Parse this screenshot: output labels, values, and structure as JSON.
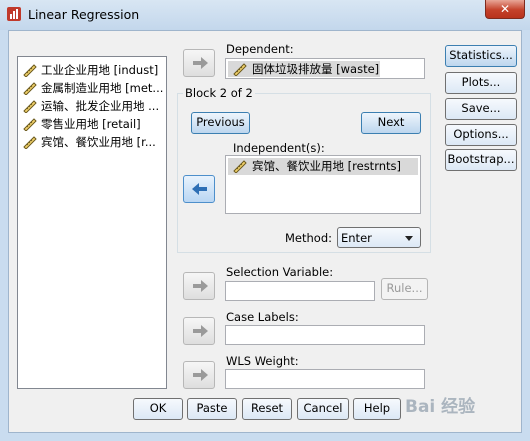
{
  "window": {
    "title": "Linear Regression",
    "close_label": "✕"
  },
  "variable_list": [
    "工业企业用地 [indust]",
    "金属制造业用地 [met...",
    "运输、批发企业用地 ...",
    "零售业用地 [retail]",
    "宾馆、餐饮业用地 [r..."
  ],
  "dependent": {
    "label": "Dependent:",
    "value": "固体垃圾排放量 [waste]"
  },
  "block": {
    "title": "Block 2 of 2",
    "previous_label": "Previous",
    "next_label": "Next",
    "independent_label": "Independent(s):",
    "independent_items": [
      "宾馆、餐饮业用地 [restrnts]"
    ]
  },
  "method": {
    "label": "Method:",
    "value": "Enter"
  },
  "selection_variable": {
    "label": "Selection Variable:",
    "value": "",
    "rule_label": "Rule..."
  },
  "case_labels": {
    "label": "Case Labels:",
    "value": ""
  },
  "wls_weight": {
    "label": "WLS Weight:",
    "value": ""
  },
  "side_buttons": [
    "Statistics...",
    "Plots...",
    "Save...",
    "Options...",
    "Bootstrap..."
  ],
  "bottom_buttons": [
    "OK",
    "Paste",
    "Reset",
    "Cancel",
    "Help"
  ],
  "watermark": "Bai 经验"
}
